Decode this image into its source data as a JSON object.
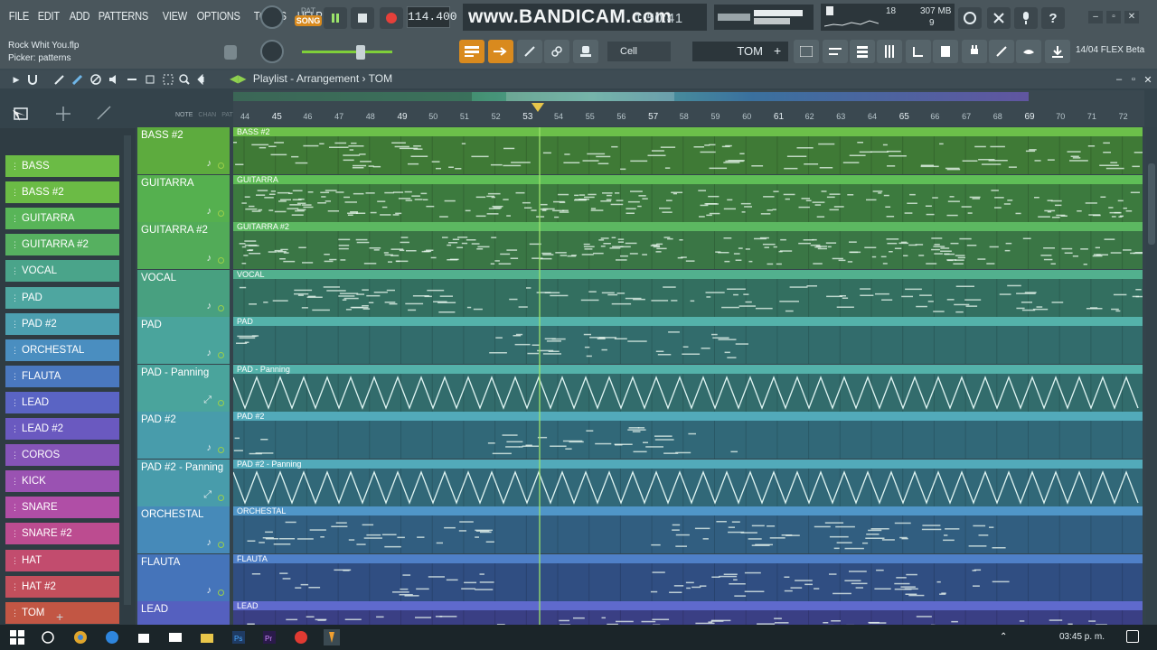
{
  "menu": [
    "FILE",
    "EDIT",
    "ADD",
    "PATTERNS",
    "VIEW",
    "OPTIONS",
    "TOOLS",
    "HELP"
  ],
  "song": {
    "file": "Rock Whit You.flp",
    "hint": "Picker: patterns"
  },
  "transport": {
    "pat_label": "PAT",
    "song_label": "SONG",
    "tempo": "114.400"
  },
  "watermark": "www.BANDICAM.com",
  "lcd_time": "1:50:41",
  "cpu": {
    "polyphony": "18",
    "memory": "307 MB",
    "voices": "9"
  },
  "snap_label": "Cell",
  "pattern_selector": "TOM",
  "news": "14/04  FLEX Beta",
  "playlist": {
    "title": "Playlist - Arrangement",
    "pattern": "TOM",
    "header_labels": [
      "NOTE",
      "CHAN",
      "PAT"
    ]
  },
  "ruler_ticks": [
    {
      "n": "44",
      "major": false
    },
    {
      "n": "45",
      "major": true
    },
    {
      "n": "46",
      "major": false
    },
    {
      "n": "47",
      "major": false
    },
    {
      "n": "48",
      "major": false
    },
    {
      "n": "49",
      "major": true
    },
    {
      "n": "50",
      "major": false
    },
    {
      "n": "51",
      "major": false
    },
    {
      "n": "52",
      "major": false
    },
    {
      "n": "53",
      "major": true
    },
    {
      "n": "54",
      "major": false
    },
    {
      "n": "55",
      "major": false
    },
    {
      "n": "56",
      "major": false
    },
    {
      "n": "57",
      "major": true
    },
    {
      "n": "58",
      "major": false
    },
    {
      "n": "59",
      "major": false
    },
    {
      "n": "60",
      "major": false
    },
    {
      "n": "61",
      "major": true
    },
    {
      "n": "62",
      "major": false
    },
    {
      "n": "63",
      "major": false
    },
    {
      "n": "64",
      "major": false
    },
    {
      "n": "65",
      "major": true
    },
    {
      "n": "66",
      "major": false
    },
    {
      "n": "67",
      "major": false
    },
    {
      "n": "68",
      "major": false
    },
    {
      "n": "69",
      "major": true
    },
    {
      "n": "70",
      "major": false
    },
    {
      "n": "71",
      "major": false
    },
    {
      "n": "72",
      "major": false
    }
  ],
  "picker_items": [
    {
      "prefix": "",
      "label": "BASS",
      "color": "#6bbb45"
    },
    {
      "prefix": "",
      "label": "BASS #2",
      "color": "#6bbb45"
    },
    {
      "prefix": "",
      "label": "GUITARRA",
      "color": "#58b558"
    },
    {
      "prefix": "",
      "label": "GUITARRA #2",
      "color": "#56b060"
    },
    {
      "prefix": "",
      "label": "VOCAL",
      "color": "#4aa48a"
    },
    {
      "prefix": "",
      "label": "PAD",
      "color": "#4ea6a0"
    },
    {
      "prefix": "",
      "label": "PAD #2",
      "color": "#4c9fb0"
    },
    {
      "prefix": "",
      "label": "ORCHESTAL",
      "color": "#4a8ec0"
    },
    {
      "prefix": "",
      "label": "FLAUTA",
      "color": "#4a78bf"
    },
    {
      "prefix": "",
      "label": "LEAD",
      "color": "#5a64c4"
    },
    {
      "prefix": "",
      "label": "LEAD #2",
      "color": "#6a59c0"
    },
    {
      "prefix": "",
      "label": "COROS",
      "color": "#8554b8"
    },
    {
      "prefix": "",
      "label": "KICK",
      "color": "#9a52b2"
    },
    {
      "prefix": "",
      "label": "SNARE",
      "color": "#b04ea6"
    },
    {
      "prefix": "",
      "label": "SNARE #2",
      "color": "#bc4c90"
    },
    {
      "prefix": "",
      "label": "HAT",
      "color": "#c24c6e"
    },
    {
      "prefix": "",
      "label": "HAT #2",
      "color": "#c24f5c"
    },
    {
      "prefix": "",
      "label": "TOM",
      "color": "#c25644"
    }
  ],
  "tracks": [
    {
      "name": "BASS #2",
      "clip": "BASS #2",
      "kind": "notes",
      "head": "#5dab3e",
      "bar": "#6cc04a",
      "body": "#3f7a36"
    },
    {
      "name": "GUITARRA",
      "clip": "GUITARRA",
      "kind": "notes",
      "head": "#55b04f",
      "bar": "#5fbe57",
      "body": "#3c7a3e"
    },
    {
      "name": "GUITARRA #2",
      "clip": "GUITARRA #2",
      "kind": "notes",
      "head": "#52ab58",
      "bar": "#5cb861",
      "body": "#3a7645"
    },
    {
      "name": "VOCAL",
      "clip": "VOCAL",
      "kind": "notes",
      "head": "#48a080",
      "bar": "#52b08e",
      "body": "#336f60"
    },
    {
      "name": "PAD",
      "clip": "PAD",
      "kind": "notes",
      "head": "#4aa49c",
      "bar": "#54b2aa",
      "body": "#326c6c"
    },
    {
      "name": "PAD - Panning",
      "clip": "PAD - Panning",
      "kind": "auto",
      "head": "#4aa49c",
      "bar": "#54b2aa",
      "body": "#326c6c"
    },
    {
      "name": "PAD #2",
      "clip": "PAD #2",
      "kind": "notes",
      "head": "#489cab",
      "bar": "#52aaba",
      "body": "#316878"
    },
    {
      "name": "PAD #2 - Panning",
      "clip": "PAD #2 - Panning",
      "kind": "auto",
      "head": "#489cab",
      "bar": "#52aaba",
      "body": "#316878"
    },
    {
      "name": "ORCHESTAL",
      "clip": "ORCHESTAL",
      "kind": "notes",
      "head": "#468ab9",
      "bar": "#5096c8",
      "body": "#315e80"
    },
    {
      "name": "FLAUTA",
      "clip": "FLAUTA",
      "kind": "notes",
      "head": "#4574ba",
      "bar": "#4f80c8",
      "body": "#304e82"
    },
    {
      "name": "LEAD",
      "clip": "LEAD",
      "kind": "notes",
      "head": "#5560bf",
      "bar": "#5f6acd",
      "body": "#3a3f84"
    }
  ],
  "taskbar_clock": "03:45 p. m."
}
